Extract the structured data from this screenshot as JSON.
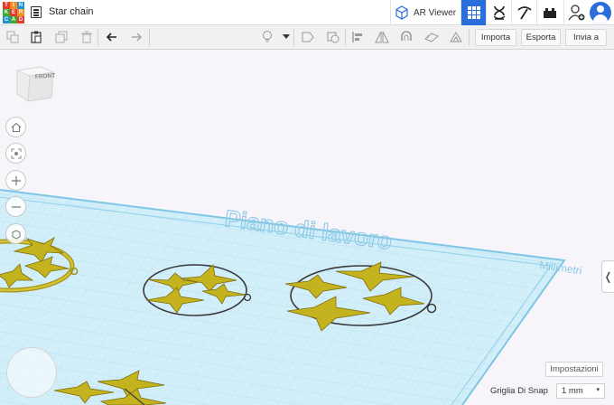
{
  "header": {
    "logo_letters": [
      "T",
      "I",
      "N",
      "K",
      "E",
      "R",
      "C",
      "A",
      "D"
    ],
    "design_title": "Star chain",
    "ar_viewer_label": "AR Viewer"
  },
  "toolbar": {
    "import_label": "Importa",
    "export_label": "Esporta",
    "send_label": "Invia a"
  },
  "workplane": {
    "watermark": "Piano di lavoro",
    "units_label": "Millimetri",
    "viewcube_label": "FRONTE"
  },
  "footer": {
    "settings_label": "Impostazioni",
    "snap_grid_label": "Griglia Di Snap",
    "snap_grid_value": "1 mm"
  },
  "colors": {
    "accent": "#2a6edb",
    "plane": "#cfeefa",
    "grid": "#9fd6ee",
    "object": "#c4b21e"
  }
}
